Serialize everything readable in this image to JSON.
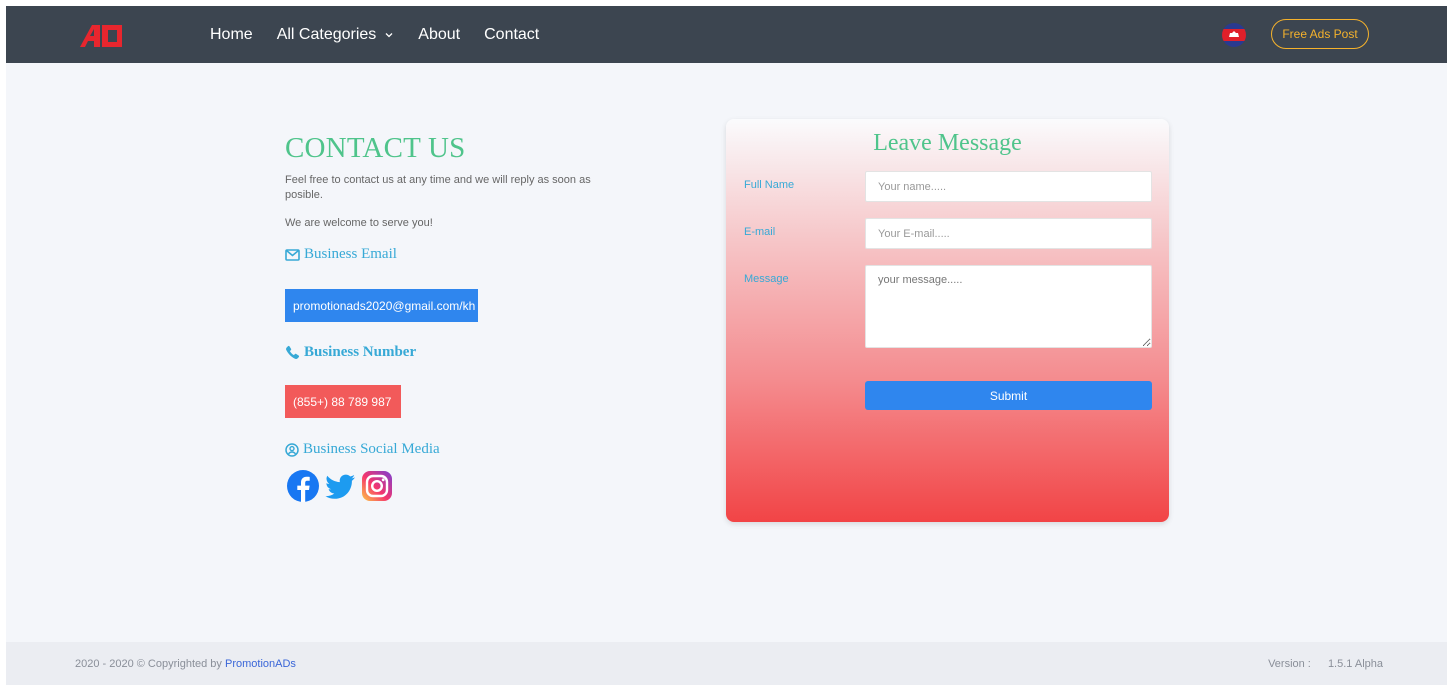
{
  "navbar": {
    "links": [
      "Home",
      "All Categories",
      "About",
      "Contact"
    ],
    "free_ads_label": "Free Ads Post",
    "colors": {
      "bg": "#3c4550",
      "accent": "#f5b22c"
    }
  },
  "contact": {
    "title": "CONTACT US",
    "intro": "Feel free to contact us at any time and we will reply as soon as posible.",
    "welcome": "We are welcome to serve you!",
    "email_heading": "Business Email",
    "email_value": "promotionads2020@gmail.com/kh",
    "phone_heading": "Business Number",
    "phone_value": "(855+) 88 789 987",
    "social_heading": "Business Social Media",
    "social_icons": [
      "facebook-icon",
      "twitter-icon",
      "instagram-icon"
    ]
  },
  "form": {
    "title": "Leave Message",
    "fullname_label": "Full Name",
    "fullname_placeholder": "Your name.....",
    "email_label": "E-mail",
    "email_placeholder": "Your E-mail.....",
    "message_label": "Message",
    "message_placeholder": "your message.....",
    "submit_label": "Submit"
  },
  "footer": {
    "years": "2020 - 2020 © Copyrighted by",
    "brand": "PromotionADs",
    "version_label": "Version :",
    "version_value": "1.5.1 Alpha"
  }
}
